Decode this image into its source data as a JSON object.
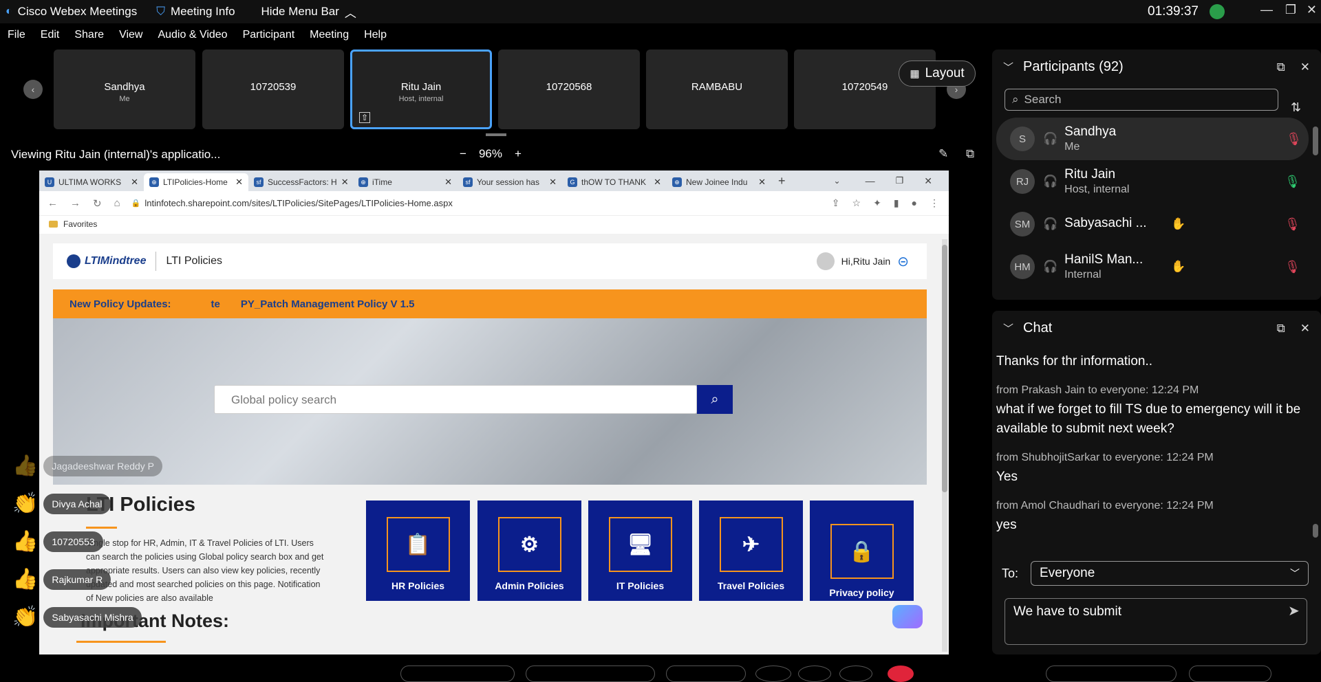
{
  "titlebar": {
    "app_name": "Cisco Webex Meetings",
    "meeting_info": "Meeting Info",
    "hide_menu": "Hide Menu Bar",
    "clock": "01:39:37"
  },
  "menu": [
    "File",
    "Edit",
    "Share",
    "View",
    "Audio & Video",
    "Participant",
    "Meeting",
    "Help"
  ],
  "strip": {
    "tiles": [
      {
        "name": "Sandhya",
        "sub": "Me"
      },
      {
        "name": "10720539",
        "sub": ""
      },
      {
        "name": "Ritu Jain",
        "sub": "Host, internal"
      },
      {
        "name": "10720568",
        "sub": ""
      },
      {
        "name": "RAMBABU",
        "sub": ""
      },
      {
        "name": "10720549",
        "sub": ""
      }
    ],
    "layout_label": "Layout"
  },
  "viewbar": {
    "viewing_text": "Viewing Ritu Jain (internal)'s applicatio...",
    "zoom": "96%"
  },
  "browser": {
    "tabs": [
      {
        "fav": "U",
        "title": "ULTIMA WORKS"
      },
      {
        "fav": "⊕",
        "title": "LTIPolicies-Home"
      },
      {
        "fav": "sf",
        "title": "SuccessFactors: H"
      },
      {
        "fav": "⊕",
        "title": "iTime"
      },
      {
        "fav": "sf",
        "title": "Your session has"
      },
      {
        "fav": "G",
        "title": "thOW TO THANK"
      },
      {
        "fav": "⊕",
        "title": "New Joinee Indu"
      }
    ],
    "url": "lntinfotech.sharepoint.com/sites/LTIPolicies/SitePages/LTIPolicies-Home.aspx",
    "favorites": "Favorites"
  },
  "sharepoint": {
    "logo": "LTIMindtree",
    "site_name": "LTI Policies",
    "greeting": "Hi,Ritu Jain",
    "updates_label": "New Policy Updates:",
    "updates_fragment": "te",
    "updates_item": "PY_Patch Management Policy V 1.5",
    "search_placeholder": "Global policy search",
    "title": "LTI Policies",
    "description": "Single stop for HR, Admin, IT & Travel Policies of LTI. Users can search the policies using Global policy search box and get appropriate results. Users can also view key policies, recently updated and most searched policies on this page. Notification of New policies are also available",
    "important": "Important Notes:",
    "cards": [
      {
        "label": "HR Policies",
        "icon": "📋"
      },
      {
        "label": "Admin Policies",
        "icon": "⚙"
      },
      {
        "label": "IT Policies",
        "icon": "🖥"
      },
      {
        "label": "Travel Policies",
        "icon": "✈"
      },
      {
        "label": "Privacy policy",
        "icon": "🔒"
      }
    ]
  },
  "reactions": [
    {
      "name": "Jagadeeshwar Reddy P",
      "emoji": "👍"
    },
    {
      "name": "Divya Achal",
      "emoji": "👏"
    },
    {
      "name": "10720553",
      "emoji": "👍"
    },
    {
      "name": "Rajkumar R",
      "emoji": "👍"
    },
    {
      "name": "Sabyasachi Mishra",
      "emoji": "👏"
    }
  ],
  "participants": {
    "title": "Participants (92)",
    "search_placeholder": "Search",
    "list": [
      {
        "initials": "S",
        "name": "Sandhya",
        "sub": "Me",
        "hand": false,
        "mic": "muted"
      },
      {
        "initials": "RJ",
        "name": "Ritu Jain",
        "sub": "Host, internal",
        "hand": false,
        "mic": "active"
      },
      {
        "initials": "SM",
        "name": "Sabyasachi ...",
        "sub": "",
        "hand": true,
        "mic": "muted"
      },
      {
        "initials": "HM",
        "name": "HanilS Man...",
        "sub": "Internal",
        "hand": true,
        "mic": "muted"
      }
    ]
  },
  "chat": {
    "title": "Chat",
    "messages": [
      {
        "meta": "",
        "text": "Thanks for thr information.."
      },
      {
        "meta": "from Prakash Jain to everyone:   12:24 PM",
        "text": "what if we forget to fill TS due to emergency will it be available to submit next week?"
      },
      {
        "meta": "from ShubhojitSarkar to everyone:   12:24 PM",
        "text": "Yes"
      },
      {
        "meta": "from Amol Chaudhari to everyone:   12:24 PM",
        "text": "yes"
      }
    ],
    "to_label": "To:",
    "to_value": "Everyone",
    "draft": "We have to submit"
  },
  "colors": {
    "accent": "#4aa3ff",
    "policy_blue": "#0b1e8c",
    "policy_orange": "#f7941d",
    "mic_muted": "#e0455a",
    "mic_active": "#2ecc71"
  }
}
